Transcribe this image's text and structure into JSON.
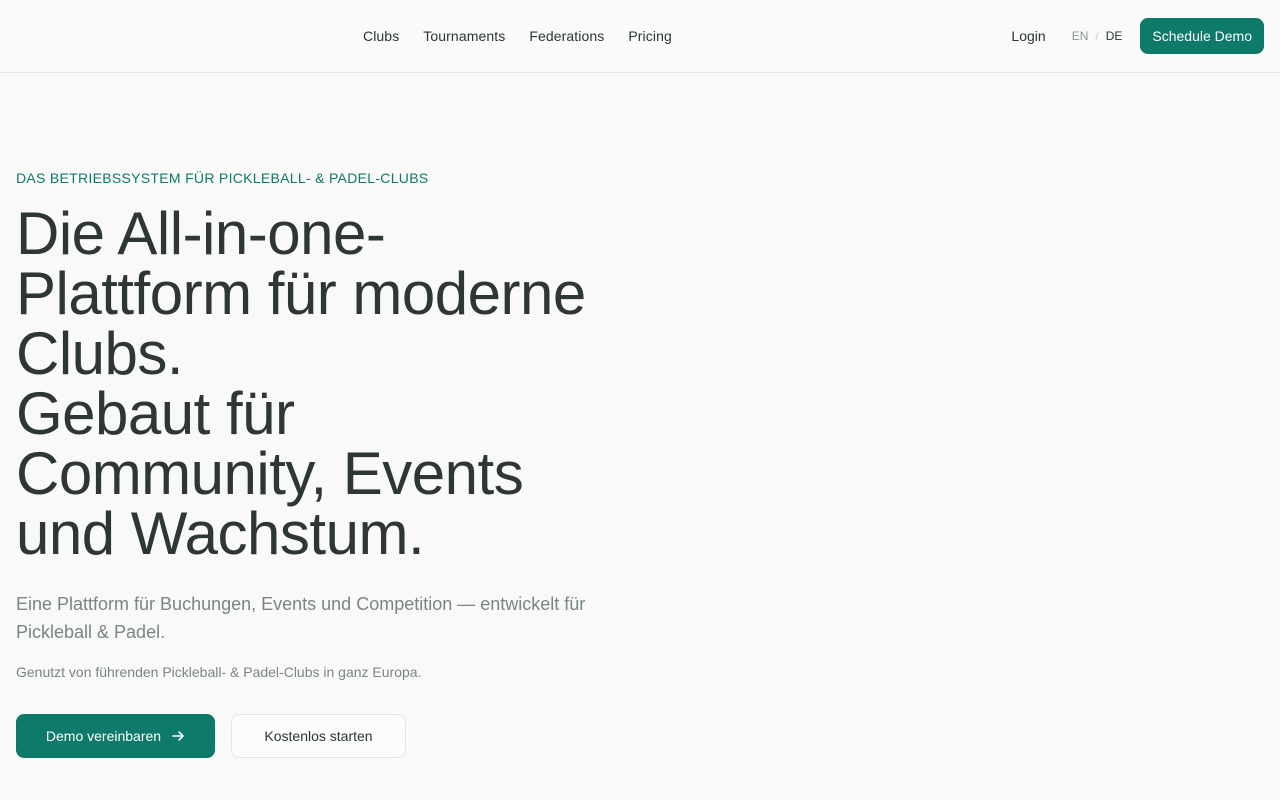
{
  "nav": {
    "items": [
      {
        "label": "Clubs"
      },
      {
        "label": "Tournaments"
      },
      {
        "label": "Federations"
      },
      {
        "label": "Pricing"
      }
    ],
    "login_label": "Login",
    "lang_en": "EN",
    "lang_separator": "/",
    "lang_de": "DE",
    "cta_label": "Schedule Demo"
  },
  "hero": {
    "eyebrow": "DAS BETRIEBSSYSTEM FÜR PICKLEBALL- & PADEL-CLUBS",
    "headline_lines": [
      "Die All-in-one-",
      "Plattform für moderne",
      "Clubs.",
      "Gebaut für",
      "Community, Events",
      "und Wachstum."
    ],
    "subheadline": "Eine Plattform für Buchungen, Events und Competition — entwickelt für Pickleball & Padel.",
    "trust_line": "Genutzt von führenden Pickleball- & Padel-Clubs in ganz Europa.",
    "primary_cta": "Demo vereinbaren",
    "primary_cta_icon": "arrow-right-icon",
    "secondary_cta": "Kostenlos starten"
  },
  "colors": {
    "accent": "#0d7a6a",
    "text": "#2e3733",
    "muted": "#7a8681",
    "background": "#f8f9f8"
  }
}
